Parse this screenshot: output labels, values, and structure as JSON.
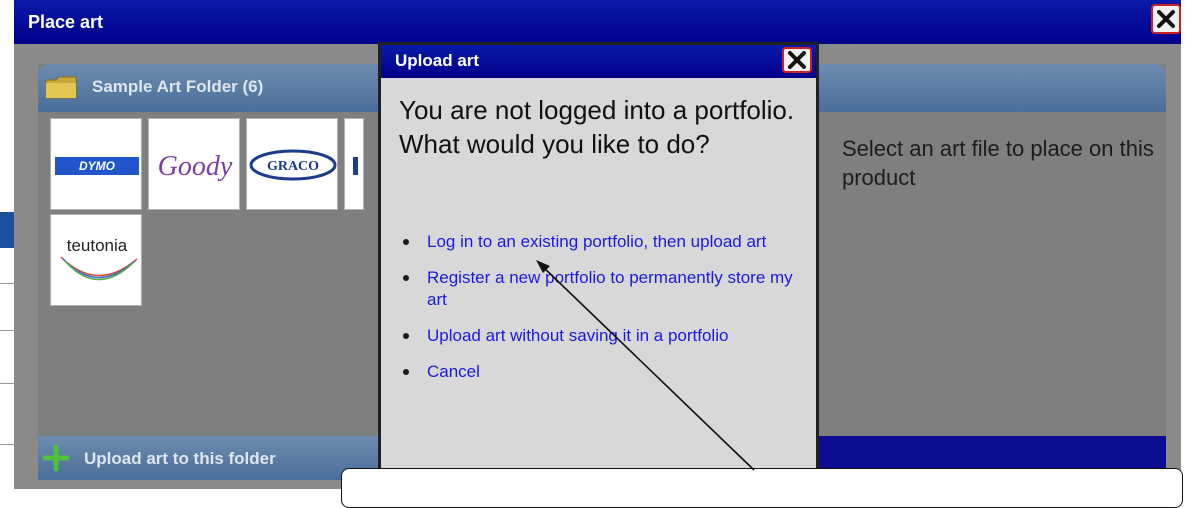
{
  "window": {
    "title": "Place art",
    "close_icon": "close-icon"
  },
  "folder": {
    "label": "Sample Art Folder (6)",
    "icon": "folder-icon"
  },
  "thumbnails": [
    {
      "name": "DYMO",
      "brand_color": "#2255cc"
    },
    {
      "name": "Goody",
      "brand_color": "#7a3fa0"
    },
    {
      "name": "GRACO",
      "brand_color": "#1a3c8c"
    },
    {
      "name": "IR",
      "brand_color": "#1a3c8c"
    },
    {
      "name": "teutonia",
      "brand_color": "#222222"
    }
  ],
  "upload_bar": {
    "label": "Upload art to this folder",
    "icon": "plus-icon"
  },
  "side_text": "Select an art file to place on this product",
  "dialog": {
    "title": "Upload art",
    "question": "You are not logged into a portfolio. What would you like to do?",
    "options": [
      "Log in to an existing portfolio, then upload art",
      "Register a new portfolio to permanently store my art",
      "Upload art without saving it in a portfolio",
      "Cancel"
    ]
  },
  "colors": {
    "title_bar": "#00008a",
    "link": "#1a1adf",
    "close_border": "#cc2222"
  }
}
